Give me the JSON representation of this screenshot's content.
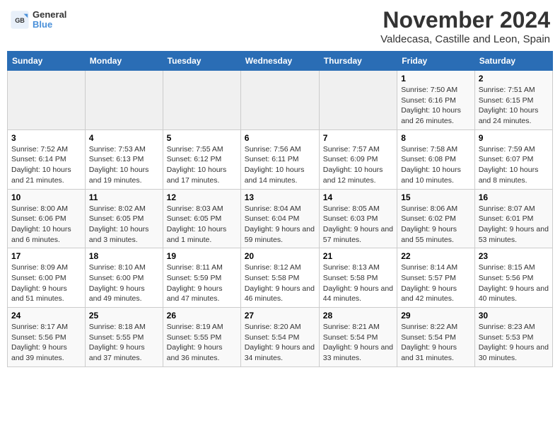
{
  "logo": {
    "text_general": "General",
    "text_blue": "Blue"
  },
  "title": "November 2024",
  "subtitle": "Valdecasa, Castille and Leon, Spain",
  "days_of_week": [
    "Sunday",
    "Monday",
    "Tuesday",
    "Wednesday",
    "Thursday",
    "Friday",
    "Saturday"
  ],
  "weeks": [
    [
      {
        "day": "",
        "info": ""
      },
      {
        "day": "",
        "info": ""
      },
      {
        "day": "",
        "info": ""
      },
      {
        "day": "",
        "info": ""
      },
      {
        "day": "",
        "info": ""
      },
      {
        "day": "1",
        "info": "Sunrise: 7:50 AM\nSunset: 6:16 PM\nDaylight: 10 hours and 26 minutes."
      },
      {
        "day": "2",
        "info": "Sunrise: 7:51 AM\nSunset: 6:15 PM\nDaylight: 10 hours and 24 minutes."
      }
    ],
    [
      {
        "day": "3",
        "info": "Sunrise: 7:52 AM\nSunset: 6:14 PM\nDaylight: 10 hours and 21 minutes."
      },
      {
        "day": "4",
        "info": "Sunrise: 7:53 AM\nSunset: 6:13 PM\nDaylight: 10 hours and 19 minutes."
      },
      {
        "day": "5",
        "info": "Sunrise: 7:55 AM\nSunset: 6:12 PM\nDaylight: 10 hours and 17 minutes."
      },
      {
        "day": "6",
        "info": "Sunrise: 7:56 AM\nSunset: 6:11 PM\nDaylight: 10 hours and 14 minutes."
      },
      {
        "day": "7",
        "info": "Sunrise: 7:57 AM\nSunset: 6:09 PM\nDaylight: 10 hours and 12 minutes."
      },
      {
        "day": "8",
        "info": "Sunrise: 7:58 AM\nSunset: 6:08 PM\nDaylight: 10 hours and 10 minutes."
      },
      {
        "day": "9",
        "info": "Sunrise: 7:59 AM\nSunset: 6:07 PM\nDaylight: 10 hours and 8 minutes."
      }
    ],
    [
      {
        "day": "10",
        "info": "Sunrise: 8:00 AM\nSunset: 6:06 PM\nDaylight: 10 hours and 6 minutes."
      },
      {
        "day": "11",
        "info": "Sunrise: 8:02 AM\nSunset: 6:05 PM\nDaylight: 10 hours and 3 minutes."
      },
      {
        "day": "12",
        "info": "Sunrise: 8:03 AM\nSunset: 6:05 PM\nDaylight: 10 hours and 1 minute."
      },
      {
        "day": "13",
        "info": "Sunrise: 8:04 AM\nSunset: 6:04 PM\nDaylight: 9 hours and 59 minutes."
      },
      {
        "day": "14",
        "info": "Sunrise: 8:05 AM\nSunset: 6:03 PM\nDaylight: 9 hours and 57 minutes."
      },
      {
        "day": "15",
        "info": "Sunrise: 8:06 AM\nSunset: 6:02 PM\nDaylight: 9 hours and 55 minutes."
      },
      {
        "day": "16",
        "info": "Sunrise: 8:07 AM\nSunset: 6:01 PM\nDaylight: 9 hours and 53 minutes."
      }
    ],
    [
      {
        "day": "17",
        "info": "Sunrise: 8:09 AM\nSunset: 6:00 PM\nDaylight: 9 hours and 51 minutes."
      },
      {
        "day": "18",
        "info": "Sunrise: 8:10 AM\nSunset: 6:00 PM\nDaylight: 9 hours and 49 minutes."
      },
      {
        "day": "19",
        "info": "Sunrise: 8:11 AM\nSunset: 5:59 PM\nDaylight: 9 hours and 47 minutes."
      },
      {
        "day": "20",
        "info": "Sunrise: 8:12 AM\nSunset: 5:58 PM\nDaylight: 9 hours and 46 minutes."
      },
      {
        "day": "21",
        "info": "Sunrise: 8:13 AM\nSunset: 5:58 PM\nDaylight: 9 hours and 44 minutes."
      },
      {
        "day": "22",
        "info": "Sunrise: 8:14 AM\nSunset: 5:57 PM\nDaylight: 9 hours and 42 minutes."
      },
      {
        "day": "23",
        "info": "Sunrise: 8:15 AM\nSunset: 5:56 PM\nDaylight: 9 hours and 40 minutes."
      }
    ],
    [
      {
        "day": "24",
        "info": "Sunrise: 8:17 AM\nSunset: 5:56 PM\nDaylight: 9 hours and 39 minutes."
      },
      {
        "day": "25",
        "info": "Sunrise: 8:18 AM\nSunset: 5:55 PM\nDaylight: 9 hours and 37 minutes."
      },
      {
        "day": "26",
        "info": "Sunrise: 8:19 AM\nSunset: 5:55 PM\nDaylight: 9 hours and 36 minutes."
      },
      {
        "day": "27",
        "info": "Sunrise: 8:20 AM\nSunset: 5:54 PM\nDaylight: 9 hours and 34 minutes."
      },
      {
        "day": "28",
        "info": "Sunrise: 8:21 AM\nSunset: 5:54 PM\nDaylight: 9 hours and 33 minutes."
      },
      {
        "day": "29",
        "info": "Sunrise: 8:22 AM\nSunset: 5:54 PM\nDaylight: 9 hours and 31 minutes."
      },
      {
        "day": "30",
        "info": "Sunrise: 8:23 AM\nSunset: 5:53 PM\nDaylight: 9 hours and 30 minutes."
      }
    ]
  ]
}
